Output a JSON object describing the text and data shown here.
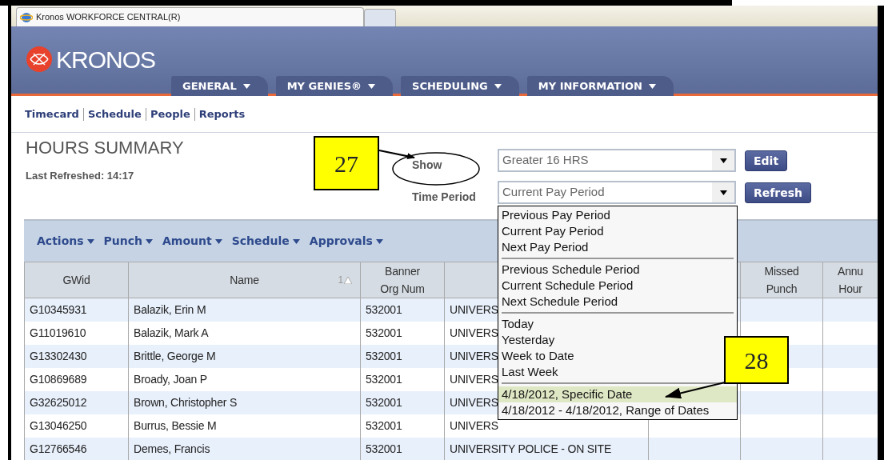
{
  "browser_tab": {
    "title": "Kronos WORKFORCE CENTRAL(R)"
  },
  "header": {
    "logo": "KRONOS",
    "tabs": [
      {
        "label": "GENERAL"
      },
      {
        "label": "MY GENIES®"
      },
      {
        "label": "SCHEDULING"
      },
      {
        "label": "MY INFORMATION"
      }
    ]
  },
  "links": [
    "Timecard",
    "Schedule",
    "People",
    "Reports"
  ],
  "page": {
    "title": "HOURS SUMMARY",
    "last_refreshed": "Last Refreshed: 14:17"
  },
  "filters": [
    {
      "label": "Show",
      "value": "Greater 16 HRS",
      "button": "Edit",
      "circled": true,
      "expanded": false
    },
    {
      "label": "Time Period",
      "value": "Current Pay Period",
      "button": "Refresh",
      "circled": false,
      "expanded": true
    }
  ],
  "dropdown": {
    "groups": [
      [
        {
          "label": "Previous Pay Period",
          "selected": false
        },
        {
          "label": "Current Pay Period",
          "selected": false
        },
        {
          "label": "Next Pay Period",
          "selected": false
        }
      ],
      [
        {
          "label": "Previous Schedule Period",
          "selected": false
        },
        {
          "label": "Current Schedule Period",
          "selected": false
        },
        {
          "label": "Next Schedule Period",
          "selected": false
        }
      ],
      [
        {
          "label": "Today",
          "selected": false
        },
        {
          "label": "Yesterday",
          "selected": false
        },
        {
          "label": "Week to Date",
          "selected": false
        },
        {
          "label": "Last Week",
          "selected": false
        }
      ],
      [
        {
          "label": "4/18/2012, Specific Date",
          "selected": true
        },
        {
          "label": "4/18/2012 - 4/18/2012, Range of Dates",
          "selected": false
        }
      ]
    ]
  },
  "toolbar": [
    "Actions",
    "Punch",
    "Amount",
    "Schedule",
    "Approvals"
  ],
  "table": {
    "columns": [
      {
        "lines": [
          "GWid"
        ]
      },
      {
        "lines": [
          "Name"
        ],
        "sort_rank": "1"
      },
      {
        "lines": [
          "Banner",
          "Org Num"
        ]
      },
      {},
      {},
      {
        "lines": [
          "Missed",
          "Punch"
        ]
      },
      {
        "lines": [
          "Annu",
          "Hour"
        ]
      }
    ],
    "rows": [
      [
        "G10345931",
        "Balazik, Erin M",
        "532001",
        "UNIVERS"
      ],
      [
        "G11019610",
        "Balazik, Mark A",
        "532001",
        "UNIVERS"
      ],
      [
        "G13302430",
        "Brittle, George M",
        "532001",
        "UNIVERS"
      ],
      [
        "G10869689",
        "Broady, Joan P",
        "532001",
        "UNIVERS"
      ],
      [
        "G32625012",
        "Brown, Christopher S",
        "532001",
        "UNIVERS"
      ],
      [
        "G13046250",
        "Burrus, Bessie M",
        "532001",
        "UNIVERS"
      ],
      [
        "G12766546",
        "Demes, Francis",
        "532001",
        "UNIVERSITY POLICE - ON SITE"
      ]
    ]
  },
  "callouts": [
    {
      "number": "27"
    },
    {
      "number": "28"
    }
  ]
}
